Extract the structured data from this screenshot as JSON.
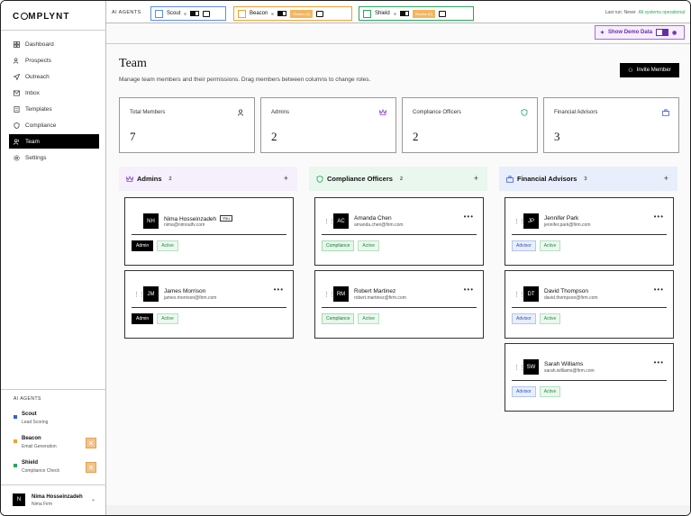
{
  "brand": {
    "logo_text_a": "C",
    "logo_text_b": "MPLYNT"
  },
  "nav": [
    {
      "label": "Dashboard",
      "icon": "dashboard-icon"
    },
    {
      "label": "Prospects",
      "icon": "users-icon"
    },
    {
      "label": "Outreach",
      "icon": "send-icon"
    },
    {
      "label": "Inbox",
      "icon": "inbox-icon"
    },
    {
      "label": "Templates",
      "icon": "template-icon"
    },
    {
      "label": "Compliance",
      "icon": "shield-icon"
    },
    {
      "label": "Team",
      "icon": "team-icon",
      "active": true
    },
    {
      "label": "Settings",
      "icon": "gear-icon"
    }
  ],
  "sidebar_agents": {
    "title": "AI AGENTS",
    "items": [
      {
        "name": "Scout",
        "role": "Lead Scoring",
        "color": "#3b5bdb"
      },
      {
        "name": "Beacon",
        "role": "Email Generation",
        "color": "#f0a030"
      },
      {
        "name": "Shield",
        "role": "Compliance Check",
        "color": "#2aa55a"
      }
    ]
  },
  "user": {
    "initial": "N",
    "name": "Nima Hosseinzadeh",
    "firm": "Nima Firm"
  },
  "topbar": {
    "label": "AI AGENTS",
    "agents": [
      {
        "name": "Scout",
        "color": "#5b8def"
      },
      {
        "name": "Beacon",
        "color": "#f0a030",
        "review": "Review (0)"
      },
      {
        "name": "Shield",
        "color": "#2aa55a",
        "review": "Review (0)"
      }
    ],
    "last_run": "Last run: Never",
    "status": "All systems operational"
  },
  "demo": {
    "label": "Show Demo Data"
  },
  "page": {
    "title": "Team",
    "description": "Manage team members and their permissions. Drag members between columns to change roles.",
    "invite_label": "Invite Member"
  },
  "stats": [
    {
      "label": "Total Members",
      "value": "7",
      "icon": "users-icon"
    },
    {
      "label": "Admins",
      "value": "2",
      "icon": "crown-icon"
    },
    {
      "label": "Compliance Officers",
      "value": "2",
      "icon": "shield-icon"
    },
    {
      "label": "Financial Advisors",
      "value": "3",
      "icon": "briefcase-icon"
    }
  ],
  "columns": [
    {
      "title": "Admins",
      "count": "2",
      "bg": "#f6effc",
      "icon_color": "#8a3fd0",
      "members": [
        {
          "initials": "NH",
          "name": "Nima Hosseinzadeh",
          "email": "nima@nimoutfv.com",
          "you": "You",
          "role": "Admin"
        },
        {
          "initials": "JM",
          "name": "James Morrison",
          "email": "james.morrison@firm.com",
          "role": "Admin"
        }
      ]
    },
    {
      "title": "Compliance Officers",
      "count": "2",
      "bg": "#e9f7ee",
      "icon_color": "#2aa55a",
      "members": [
        {
          "initials": "AC",
          "name": "Amanda Chen",
          "email": "amanda.chen@firm.com",
          "role": "Compliance"
        },
        {
          "initials": "RM",
          "name": "Robert Martinez",
          "email": "robert.martinez@firm.com",
          "role": "Compliance"
        }
      ]
    },
    {
      "title": "Financial Advisors",
      "count": "3",
      "bg": "#e8eefb",
      "icon_color": "#3b5bdb",
      "members": [
        {
          "initials": "JP",
          "name": "Jennifer Park",
          "email": "jennifer.park@firm.com",
          "role": "Advisor"
        },
        {
          "initials": "DT",
          "name": "David Thompson",
          "email": "david.thompson@firm.com",
          "role": "Advisor"
        },
        {
          "initials": "SW",
          "name": "Sarah Williams",
          "email": "sarah.williams@firm.com",
          "role": "Advisor"
        }
      ]
    }
  ],
  "status_label": "Active"
}
